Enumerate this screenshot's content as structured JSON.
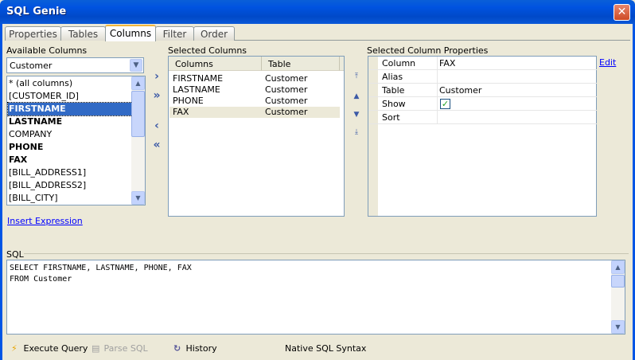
{
  "window": {
    "title": "SQL Genie",
    "close": "✕"
  },
  "tabs": [
    {
      "label": "Properties",
      "active": false
    },
    {
      "label": "Tables",
      "active": false
    },
    {
      "label": "Columns",
      "active": true
    },
    {
      "label": "Filter",
      "active": false
    },
    {
      "label": "Order",
      "active": false
    }
  ],
  "available": {
    "label": "Available Columns",
    "table": "Customer",
    "items": [
      {
        "text": "* (all columns)",
        "bold": false,
        "selected": false
      },
      {
        "text": "[CUSTOMER_ID]",
        "bold": false,
        "selected": false
      },
      {
        "text": "FIRSTNAME",
        "bold": true,
        "selected": true
      },
      {
        "text": "LASTNAME",
        "bold": true,
        "selected": false
      },
      {
        "text": "COMPANY",
        "bold": false,
        "selected": false
      },
      {
        "text": "PHONE",
        "bold": true,
        "selected": false
      },
      {
        "text": "FAX",
        "bold": true,
        "selected": false
      },
      {
        "text": "[BILL_ADDRESS1]",
        "bold": false,
        "selected": false
      },
      {
        "text": "[BILL_ADDRESS2]",
        "bold": false,
        "selected": false
      },
      {
        "text": "[BILL_CITY]",
        "bold": false,
        "selected": false
      }
    ],
    "insert_expression": "Insert Expression"
  },
  "move_buttons": {
    "add": "›",
    "add_all": "»",
    "remove": "‹",
    "remove_all": "«"
  },
  "selected": {
    "label": "Selected Columns",
    "headers": [
      "Columns",
      "Table"
    ],
    "rows": [
      [
        "FIRSTNAME",
        "Customer"
      ],
      [
        "LASTNAME",
        "Customer"
      ],
      [
        "PHONE",
        "Customer"
      ],
      [
        "FAX",
        "Customer"
      ]
    ]
  },
  "properties": {
    "label": "Selected Column Properties",
    "edit": "Edit",
    "rows": [
      {
        "key": "Column",
        "value": "FAX"
      },
      {
        "key": "Alias",
        "value": ""
      },
      {
        "key": "Table",
        "value": "Customer"
      },
      {
        "key": "Show",
        "value": "",
        "checked": true
      },
      {
        "key": "Sort",
        "value": ""
      }
    ]
  },
  "sql": {
    "label": "SQL",
    "text": "SELECT FIRSTNAME, LASTNAME, PHONE, FAX\nFROM Customer"
  },
  "toolbar": {
    "execute": "Execute Query",
    "parse": "Parse SQL",
    "history": "History",
    "syntax": "Native SQL Syntax"
  },
  "colors": {
    "titlebar": "#0053e0",
    "selection": "#316ac5",
    "link": "#0000ff"
  }
}
